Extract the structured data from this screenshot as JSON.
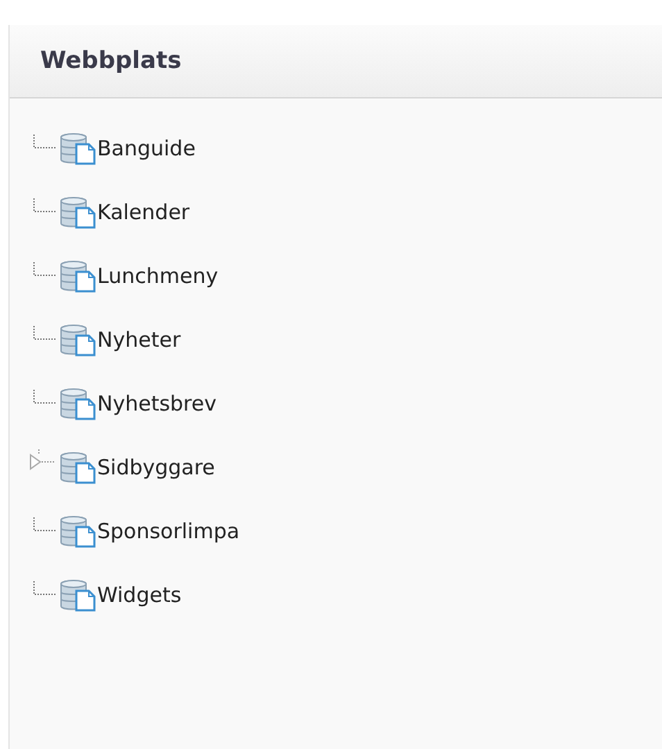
{
  "panel": {
    "title": "Webbplats"
  },
  "tree": {
    "items": [
      {
        "label": "Banguide",
        "expandable": false
      },
      {
        "label": "Kalender",
        "expandable": false
      },
      {
        "label": "Lunchmeny",
        "expandable": false
      },
      {
        "label": "Nyheter",
        "expandable": false
      },
      {
        "label": "Nyhetsbrev",
        "expandable": false
      },
      {
        "label": "Sidbyggare",
        "expandable": true
      },
      {
        "label": "Sponsorlimpa",
        "expandable": false
      },
      {
        "label": "Widgets",
        "expandable": false
      }
    ]
  }
}
